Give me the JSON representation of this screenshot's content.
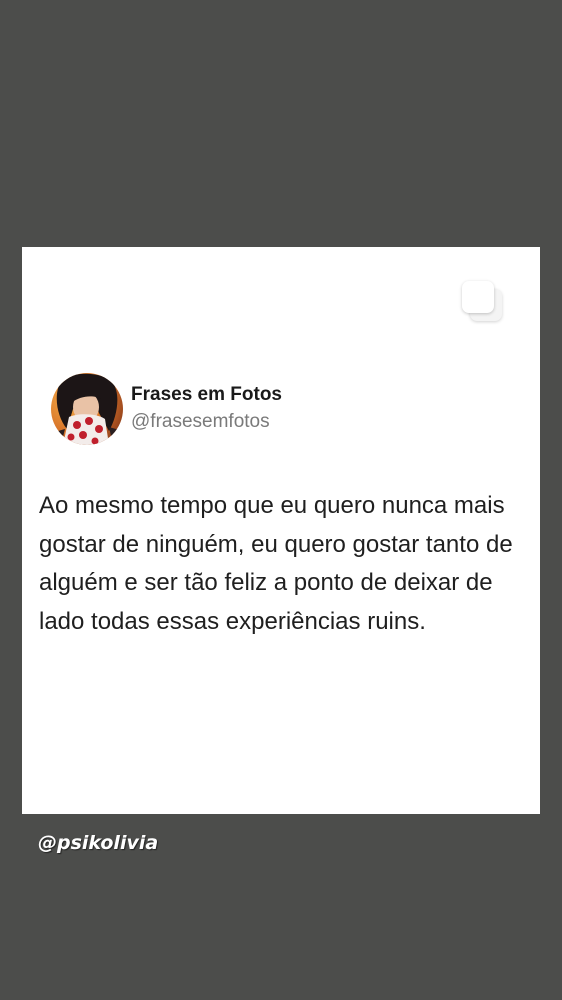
{
  "post": {
    "display_name": "Frases em Fotos",
    "handle": "@frasesemfotos",
    "text": "Ao mesmo tempo que eu quero nunca mais gostar de ninguém, eu quero gostar tanto de alguém e ser tão feliz a ponto de deixar de lado todas essas experiências ruins.",
    "avatar_icon": "profile-avatar-image",
    "multi_image_icon": "multiple-images-icon"
  },
  "story": {
    "watermark": "@psikolivia",
    "background_color": "#4c4d4b",
    "card_color": "#ffffff"
  }
}
